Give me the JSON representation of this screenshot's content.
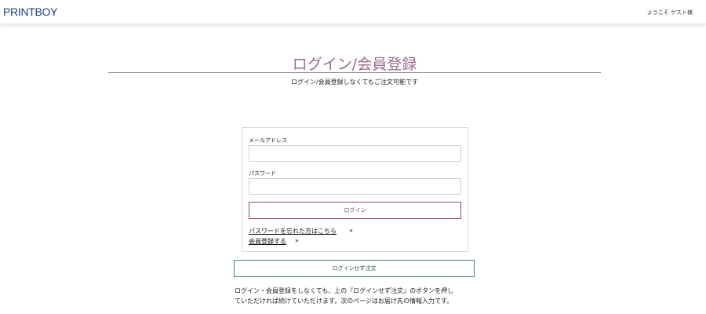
{
  "header": {
    "logo_text": "PRINTBOY",
    "welcome_text": "ようこそ ゲスト様"
  },
  "main": {
    "title": "ログイン/会員登録",
    "subtitle": "ログイン/会員登録しなくてもご注文可能です"
  },
  "login_form": {
    "email_label": "メールアドレス",
    "email_value": "",
    "password_label": "パスワード",
    "password_value": "",
    "login_button_label": "ログイン",
    "forgot_password_link": "パスワードを忘れた方はこちら",
    "register_link": "会員登録する",
    "link_arrow": "»"
  },
  "guest": {
    "button_label": "ログインせず注文",
    "note_line1": "ログイン・会員登録をしなくても、上の『ログインせず注文』のボタンを押し",
    "note_line2": "ていただければ続けていただけます。次のページはお届け先の情報入力です。"
  },
  "colors": {
    "logo": "#1b3f8f",
    "title": "#9a6b92",
    "login_button_border": "#8b4a7e",
    "guest_button_border": "#3d8d6a"
  }
}
